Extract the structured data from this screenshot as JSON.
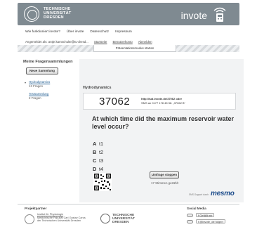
{
  "header": {
    "university_lines": [
      "TECHNISCHE",
      "UNIVERSITÄT",
      "DRESDEN"
    ],
    "brand": "invote"
  },
  "topnav": [
    "Wie funktioniert invote?",
    "Über invote",
    "Datenschutz",
    "Impressum"
  ],
  "subnav": {
    "user": "Angemeldet als: antje.kamschulte@tu-dresd...",
    "links": [
      "Startseite",
      "Benutzerkonto",
      "Abmelden"
    ]
  },
  "presentation_tab": "Präsentationsmodus starten",
  "sidebar": {
    "title": "Meine Fragensammlungen",
    "new_button": "Neue Sammlung",
    "collections": [
      {
        "name": "Hydrodynamics",
        "count": "13 Fragen"
      },
      {
        "name": "Testsammlung",
        "count": "2 Fragen"
      }
    ]
  },
  "main": {
    "title": "Hydrodynamics",
    "code": "37062",
    "info_line1": "http://tud.invote.de/37062 oder",
    "info_line2": "SMS an 0177 178 45 56: „37062 B“",
    "question": "At which time did the maximum reservoir water level occur?",
    "answers": [
      {
        "letter": "A",
        "text": "t1"
      },
      {
        "letter": "B",
        "text": "t2"
      },
      {
        "letter": "C",
        "text": "t3"
      },
      {
        "letter": "D",
        "text": "t4"
      }
    ],
    "stop_button": "Umfrage stoppen",
    "votes": "17 Stimmen gezählt",
    "sms_support": "SMS-Support durch",
    "mesmo": "mesmo"
  },
  "footer": {
    "partners_title": "Projektpartner",
    "institute_lines": [
      "Institut für Physiologie",
      "Medizinische Fakultät Carl Gustav Carus",
      "der Technischen Universität Dresden"
    ],
    "tud_lines": [
      "TECHNISCHE",
      "UNIVERSITÄT",
      "DRESDEN"
    ],
    "social_title": "Social Media",
    "like": "Gefällt mir",
    "follow": "@invote_de folgen"
  }
}
